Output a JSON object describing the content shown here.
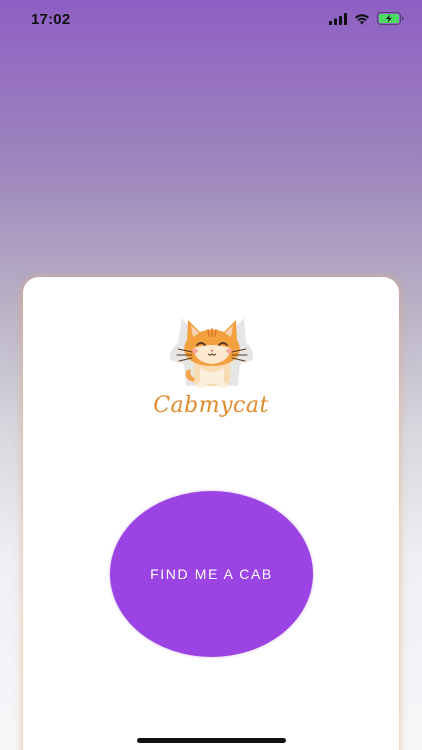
{
  "status_bar": {
    "time": "17:02",
    "icons": [
      "signal-icon",
      "wifi-icon",
      "battery-charging-icon"
    ],
    "battery_color": "#4cd964"
  },
  "brand": {
    "name": "Cabmycat",
    "logo_icon": "cat-logo-icon",
    "color": "#e08a2c"
  },
  "main": {
    "cta_label": "FIND ME A CAB",
    "cta_color": "#9b44e3"
  },
  "theme": {
    "gradient_top": "#8f5fc4",
    "gradient_bottom": "#f6f7f9"
  }
}
